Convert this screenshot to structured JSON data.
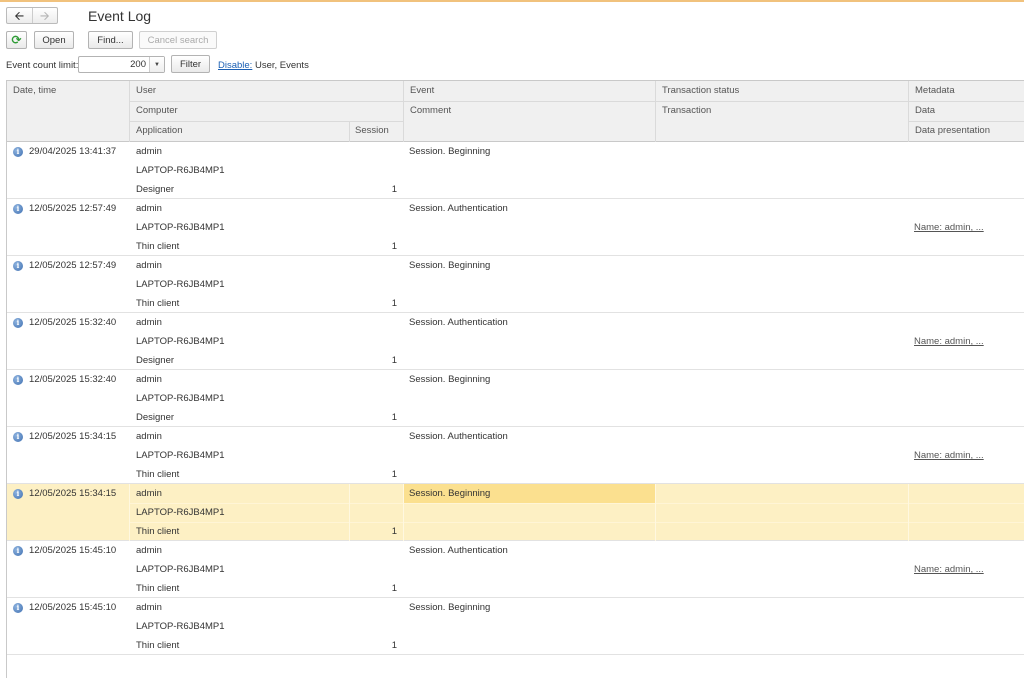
{
  "window": {
    "title": "Event Log"
  },
  "nav": {
    "back_icon": "arrow-left-icon",
    "forward_icon": "arrow-right-icon"
  },
  "toolbar": {
    "refresh_icon": "refresh-icon",
    "open_label": "Open",
    "find_label": "Find...",
    "cancel_search_label": "Cancel search"
  },
  "filter_bar": {
    "limit_label": "Event count limit:",
    "limit_value": "200",
    "filter_label": "Filter",
    "disable_label": "Disable:",
    "filter_summary": "User, Events"
  },
  "columns": {
    "date_time": "Date, time",
    "user": "User",
    "computer": "Computer",
    "application": "Application",
    "session": "Session",
    "event": "Event",
    "comment": "Comment",
    "transaction_status": "Transaction status",
    "transaction": "Transaction",
    "metadata": "Metadata",
    "data": "Data",
    "data_presentation": "Data presentation"
  },
  "rows": [
    {
      "datetime": "29/04/2025 13:41:37",
      "user": "admin",
      "computer": "LAPTOP-R6JB4MP1",
      "application": "Designer",
      "session": "1",
      "event": "Session. Beginning",
      "data": ""
    },
    {
      "datetime": "12/05/2025 12:57:49",
      "user": "admin",
      "computer": "LAPTOP-R6JB4MP1",
      "application": "Thin client",
      "session": "1",
      "event": "Session. Authentication",
      "data": "Name: admin, ..."
    },
    {
      "datetime": "12/05/2025 12:57:49",
      "user": "admin",
      "computer": "LAPTOP-R6JB4MP1",
      "application": "Thin client",
      "session": "1",
      "event": "Session. Beginning",
      "data": ""
    },
    {
      "datetime": "12/05/2025 15:32:40",
      "user": "admin",
      "computer": "LAPTOP-R6JB4MP1",
      "application": "Designer",
      "session": "1",
      "event": "Session. Authentication",
      "data": "Name: admin, ..."
    },
    {
      "datetime": "12/05/2025 15:32:40",
      "user": "admin",
      "computer": "LAPTOP-R6JB4MP1",
      "application": "Designer",
      "session": "1",
      "event": "Session. Beginning",
      "data": ""
    },
    {
      "datetime": "12/05/2025 15:34:15",
      "user": "admin",
      "computer": "LAPTOP-R6JB4MP1",
      "application": "Thin client",
      "session": "1",
      "event": "Session. Authentication",
      "data": "Name: admin, ..."
    },
    {
      "datetime": "12/05/2025 15:34:15",
      "user": "admin",
      "computer": "LAPTOP-R6JB4MP1",
      "application": "Thin client",
      "session": "1",
      "event": "Session. Beginning",
      "data": "",
      "selected": true
    },
    {
      "datetime": "12/05/2025 15:45:10",
      "user": "admin",
      "computer": "LAPTOP-R6JB4MP1",
      "application": "Thin client",
      "session": "1",
      "event": "Session. Authentication",
      "data": "Name: admin, ..."
    },
    {
      "datetime": "12/05/2025 15:45:10",
      "user": "admin",
      "computer": "LAPTOP-R6JB4MP1",
      "application": "Thin client",
      "session": "1",
      "event": "Session. Beginning",
      "data": ""
    }
  ],
  "colors": {
    "selected_row": "#fdf0c4",
    "selected_cell": "#fbe08f",
    "link": "#1a5fb4",
    "refresh": "#2e9b35"
  }
}
